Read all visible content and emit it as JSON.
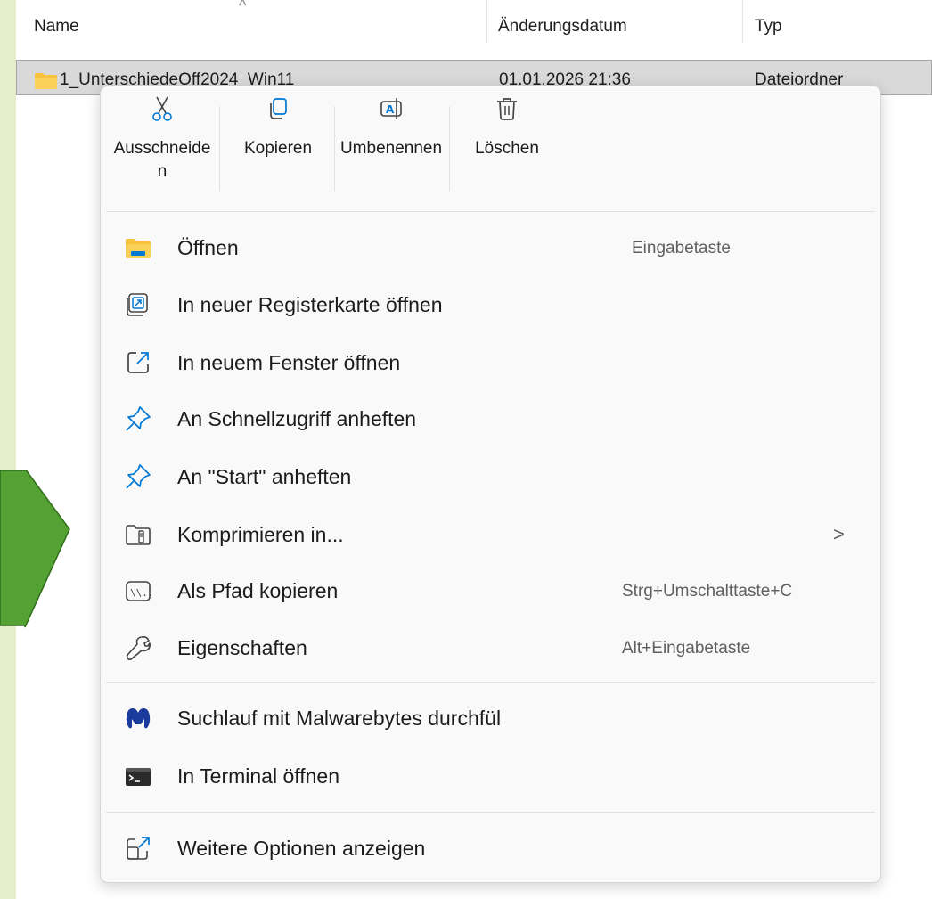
{
  "columns": {
    "name": "Name",
    "modified": "Änderungsdatum",
    "type": "Typ"
  },
  "sort_indicator": "^",
  "file": {
    "name": "1_UnterschiedeOff2024_Win11",
    "modified": "01.01.2026 21:36",
    "type": "Dateiordner"
  },
  "colors": {
    "background": "#e4eecb",
    "arrow": "#54a234",
    "menu_bg": "#f9f9f9",
    "folder": "#f8c33c",
    "accent_blue": "#0078d4"
  },
  "command_bar": [
    {
      "icon": "scissors-icon",
      "label": "Ausschneiden"
    },
    {
      "icon": "copy-icon",
      "label": "Kopieren"
    },
    {
      "icon": "rename-icon",
      "label": "Umbenennen"
    },
    {
      "icon": "trash-icon",
      "label": "Löschen"
    }
  ],
  "menu_items": [
    {
      "icon": "folder-open-icon",
      "label": "Öffnen",
      "shortcut": "Eingabetaste"
    },
    {
      "icon": "new-tab-icon",
      "label": "In neuer Registerkarte öffnen",
      "shortcut": ""
    },
    {
      "icon": "new-window-icon",
      "label": "In neuem Fenster öffnen",
      "shortcut": ""
    },
    {
      "icon": "pin-icon",
      "label": "An Schnellzugriff anheften",
      "shortcut": ""
    },
    {
      "icon": "pin-icon",
      "label": "An \"Start\" anheften",
      "shortcut": ""
    },
    {
      "icon": "zip-folder-icon",
      "label": "Komprimieren in...",
      "shortcut": "",
      "submenu_glyph": ">"
    },
    {
      "icon": "copy-path-icon",
      "label": "Als Pfad kopieren",
      "shortcut": "Strg+Umschalttaste+C"
    },
    {
      "icon": "wrench-icon",
      "label": "Eigenschaften",
      "shortcut": "Alt+Eingabetaste"
    },
    {
      "icon": "malwarebytes-icon",
      "label": "Suchlauf mit Malwarebytes durchfül",
      "shortcut": ""
    },
    {
      "icon": "terminal-icon",
      "label": "In Terminal öffnen",
      "shortcut": ""
    },
    {
      "icon": "more-options-icon",
      "label": "Weitere Optionen anzeigen",
      "shortcut": ""
    }
  ]
}
